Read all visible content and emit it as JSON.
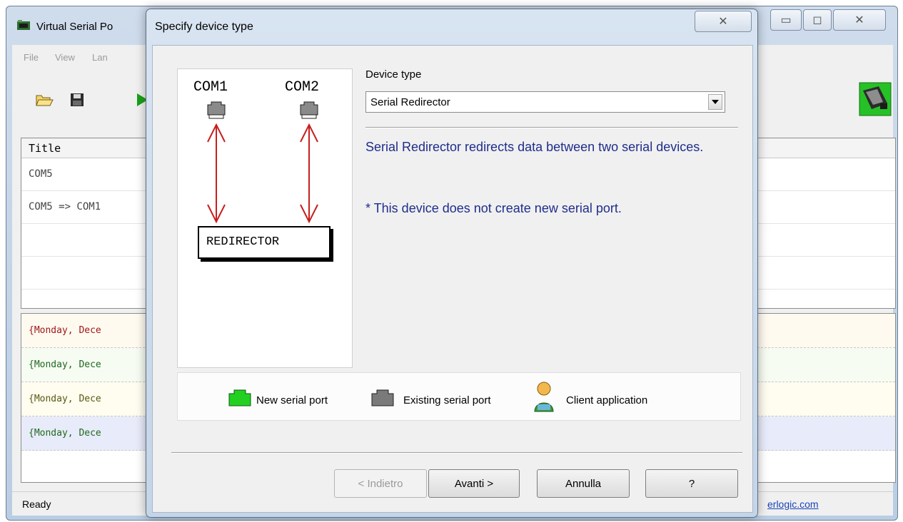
{
  "main_window": {
    "title": "Virtual Serial Po",
    "menu": [
      "File",
      "View",
      "Lan"
    ],
    "ports_table": {
      "column_title": "Title",
      "rows": [
        "COM5",
        "COM5 => COM1",
        "",
        ""
      ]
    },
    "log_rows": [
      {
        "text": "{Monday, Dece",
        "color": "#a01818"
      },
      {
        "text": "{Monday, Dece",
        "color": "#1e6a1e"
      },
      {
        "text": "{Monday, Dece",
        "color": "#5a5a10"
      },
      {
        "text": "{Monday, Dece",
        "color": "#1e6a1e"
      }
    ],
    "status": "Ready",
    "status_link": "erlogic.com",
    "window_controls": {
      "minimize": "▭",
      "maximize": "◻",
      "close": "✕"
    }
  },
  "dialog": {
    "title": "Specify device type",
    "close_glyph": "✕",
    "diagram": {
      "com_left": "COM1",
      "com_right": "COM2",
      "redirector": "REDIRECTOR"
    },
    "device_type_label": "Device type",
    "device_type_value": "Serial Redirector",
    "description": "Serial Redirector redirects data between two serial devices.",
    "note": "* This device does not create new serial port.",
    "legend": {
      "new_port": "New serial port",
      "existing_port": "Existing serial port",
      "client_app": "Client application"
    },
    "buttons": {
      "back": "< Indietro",
      "next": "Avanti >",
      "cancel": "Annulla",
      "help": "?"
    }
  },
  "colors": {
    "description_text": "#1f2d8c",
    "arrow": "#c81e1e",
    "new_port": "#22d022",
    "existing_port": "#7a7a7a",
    "play_button": "#1aa01a"
  },
  "icons": [
    "app-icon",
    "open-folder-icon",
    "save-icon",
    "play-icon",
    "serial-connector-icon",
    "port-plug-icon",
    "client-person-icon",
    "dropdown-arrow-icon"
  ]
}
